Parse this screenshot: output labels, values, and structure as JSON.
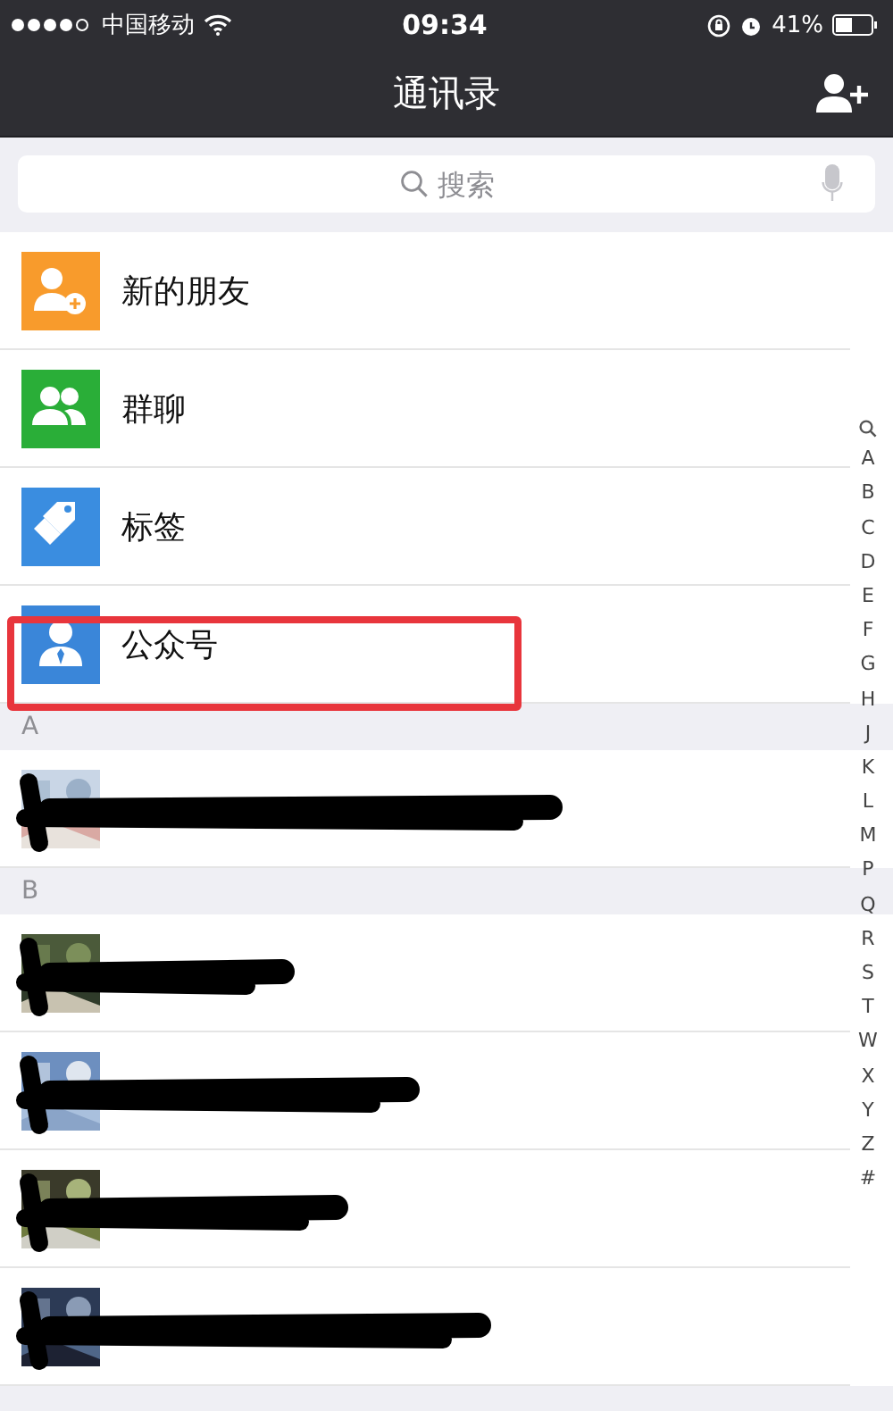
{
  "status_bar": {
    "carrier": "中国移动",
    "time": "09:34",
    "battery": "41%"
  },
  "nav": {
    "title": "通讯录"
  },
  "search": {
    "placeholder": "搜索"
  },
  "functions": [
    {
      "label": "新的朋友",
      "kind": "addperson",
      "color": "#f89b2c",
      "highlighted": false
    },
    {
      "label": "群聊",
      "kind": "group",
      "color": "#2aae38",
      "highlighted": false
    },
    {
      "label": "标签",
      "kind": "tag",
      "color": "#3a8de0",
      "highlighted": false
    },
    {
      "label": "公众号",
      "kind": "official",
      "color": "#3a86d9",
      "highlighted": true
    }
  ],
  "sections": [
    {
      "letter": "A",
      "contacts": [
        {
          "kind": "picture",
          "redacted": true
        }
      ]
    },
    {
      "letter": "B",
      "contacts": [
        {
          "kind": "picture",
          "redacted": true
        },
        {
          "kind": "picture",
          "redacted": true
        },
        {
          "kind": "picture",
          "redacted": true
        },
        {
          "kind": "picture",
          "redacted": true
        }
      ]
    }
  ],
  "index": [
    "A",
    "B",
    "C",
    "D",
    "E",
    "F",
    "G",
    "H",
    "J",
    "K",
    "L",
    "M",
    "P",
    "Q",
    "R",
    "S",
    "T",
    "W",
    "X",
    "Y",
    "Z",
    "#"
  ]
}
